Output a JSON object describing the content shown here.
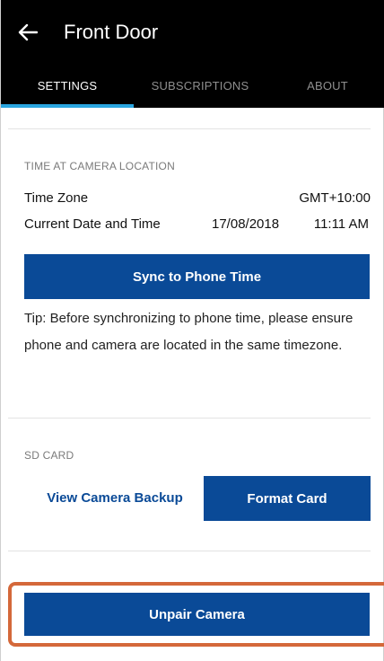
{
  "header": {
    "back_icon": "arrow-left-icon",
    "title": "Front Door"
  },
  "tabs": [
    {
      "label": "SETTINGS",
      "active": true
    },
    {
      "label": "SUBSCRIPTIONS",
      "active": false
    },
    {
      "label": "ABOUT",
      "active": false
    }
  ],
  "time_section": {
    "label": "TIME AT CAMERA LOCATION",
    "time_zone_label": "Time Zone",
    "time_zone_value": "GMT+10:00",
    "datetime_label": "Current Date and Time",
    "date_value": "17/08/2018",
    "time_value": "11:11 AM",
    "sync_button": "Sync to Phone Time",
    "tip": "Tip: Before synchronizing to phone time, please ensure phone and camera are located in the same timezone."
  },
  "sd_section": {
    "label": "SD CARD",
    "view_backup_link": "View Camera Backup",
    "format_button": "Format Card"
  },
  "unpair_button": "Unpair Camera",
  "colors": {
    "header_bg": "#000000",
    "tab_indicator": "#2aa6e0",
    "primary_button": "#0a4a97",
    "highlight_border": "#d4683a"
  }
}
